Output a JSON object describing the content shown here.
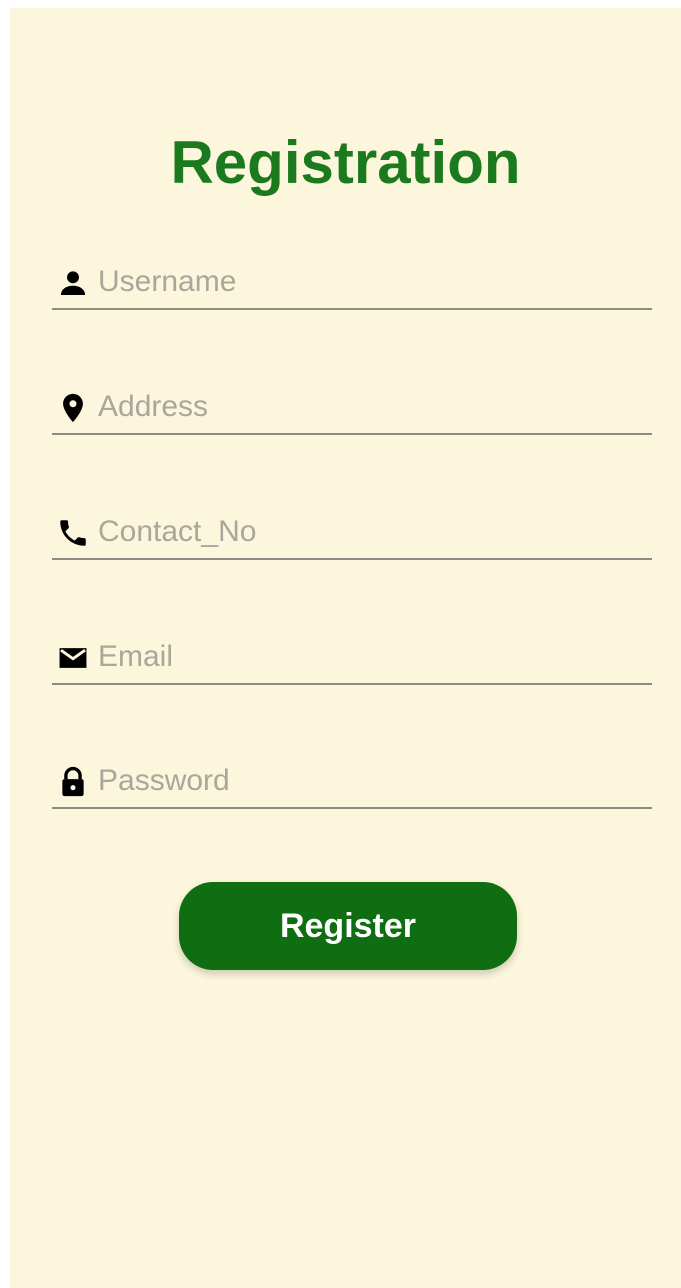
{
  "title": "Registration",
  "colors": {
    "background": "#fcf6dc",
    "title": "#1b7a1e",
    "button": "#0f6e12"
  },
  "fields": [
    {
      "icon": "person-icon",
      "placeholder": "Username",
      "value": ""
    },
    {
      "icon": "location-pin-icon",
      "placeholder": "Address",
      "value": ""
    },
    {
      "icon": "phone-icon",
      "placeholder": "Contact_No",
      "value": ""
    },
    {
      "icon": "mail-icon",
      "placeholder": "Email",
      "value": ""
    },
    {
      "icon": "lock-icon",
      "placeholder": "Password",
      "value": ""
    }
  ],
  "register_button": {
    "label": "Register"
  }
}
